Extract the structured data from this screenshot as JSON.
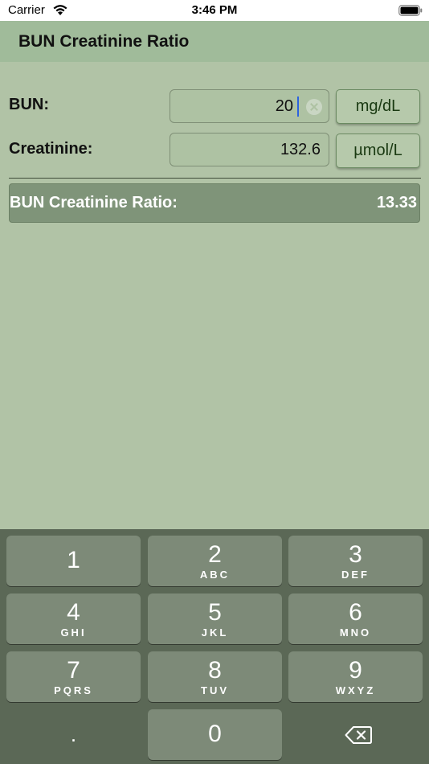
{
  "status_bar": {
    "carrier": "Carrier",
    "time": "3:46 PM",
    "wifi_icon": "wifi-icon",
    "battery_icon": "battery-icon"
  },
  "header": {
    "title": "BUN Creatinine Ratio"
  },
  "form": {
    "bun": {
      "label": "BUN:",
      "value": "20",
      "unit": "mg/dL"
    },
    "creatinine": {
      "label": "Creatinine:",
      "value": "132.6",
      "unit": "µmol/L"
    }
  },
  "result": {
    "label": "BUN Creatinine Ratio:",
    "value": "13.33"
  },
  "keypad": {
    "keys": [
      {
        "digit": "1",
        "letters": ""
      },
      {
        "digit": "2",
        "letters": "ABC"
      },
      {
        "digit": "3",
        "letters": "DEF"
      },
      {
        "digit": "4",
        "letters": "GHI"
      },
      {
        "digit": "5",
        "letters": "JKL"
      },
      {
        "digit": "6",
        "letters": "MNO"
      },
      {
        "digit": "7",
        "letters": "PQRS"
      },
      {
        "digit": "8",
        "letters": "TUV"
      },
      {
        "digit": "9",
        "letters": "WXYZ"
      },
      {
        "digit": "0",
        "letters": ""
      }
    ],
    "decimal": ".",
    "delete_icon": "backspace-icon"
  },
  "colors": {
    "background": "#b1c3a6",
    "header": "#a0bb9a",
    "result_bar": "#7f9479",
    "keypad": "#5b6856",
    "key": "#7d8a78",
    "unit_text": "#1a3a12"
  }
}
